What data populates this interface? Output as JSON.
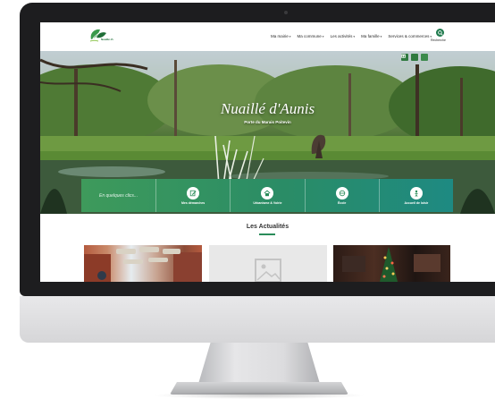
{
  "site": {
    "logo_text": "Nuaillé d'Aunis",
    "nav": [
      {
        "label": "Ma mairie"
      },
      {
        "label": "Ma commune"
      },
      {
        "label": "Les activités"
      },
      {
        "label": "Ma famille"
      },
      {
        "label": "Services & commerces"
      }
    ],
    "search_label": "Recherche"
  },
  "hero": {
    "title": "Nuaillé d'Aunis",
    "subtitle": "Porte du Marais Poitevin",
    "social_icons": [
      "facebook-icon",
      "calendar-icon",
      "mail-icon"
    ]
  },
  "quick_access": {
    "search_placeholder": "En quelques clics...",
    "items": [
      {
        "label": "Mes démarches",
        "icon": "edit-icon"
      },
      {
        "label": "Urbanisme & Voirie",
        "icon": "home-icon"
      },
      {
        "label": "École",
        "icon": "school-icon"
      },
      {
        "label": "Accueil de loisir",
        "icon": "child-icon"
      }
    ]
  },
  "news": {
    "title": "Les Actualités"
  },
  "colors": {
    "brand_green": "#2a8c5a",
    "accent_teal": "#1e8a82"
  }
}
